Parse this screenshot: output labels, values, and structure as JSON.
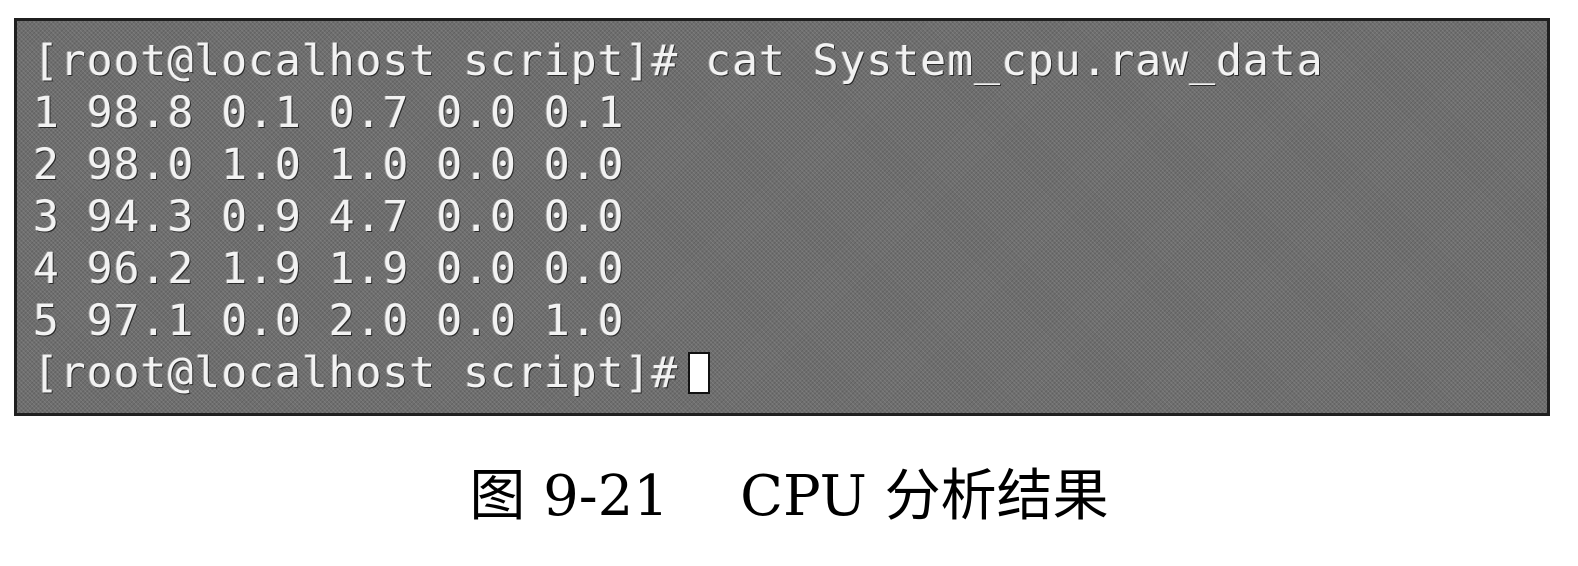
{
  "terminal": {
    "command_line": "[root@localhost script]# cat System_cpu.raw_data",
    "output_rows": [
      "1 98.8 0.1 0.7 0.0 0.1",
      "2 98.0 1.0 1.0 0.0 0.0",
      "3 94.3 0.9 4.7 0.0 0.0",
      "4 96.2 1.9 1.9 0.0 0.0",
      "5 97.1 0.0 2.0 0.0 1.0"
    ],
    "prompt": "[root@localhost script]#"
  },
  "caption": "图 9-21    CPU 分析结果"
}
